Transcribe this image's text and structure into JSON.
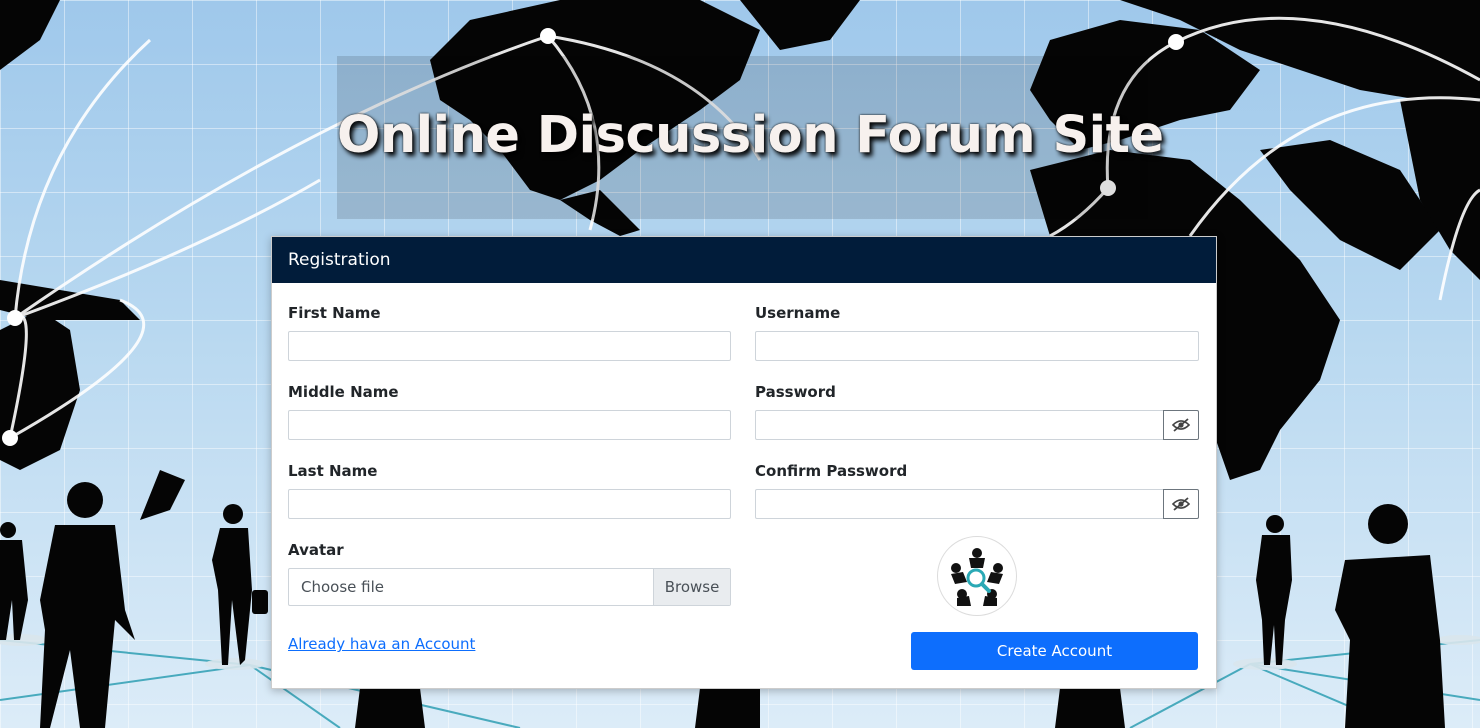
{
  "header": {
    "site_title": "Online Discussion Forum Site"
  },
  "registration": {
    "heading": "Registration",
    "fields": {
      "first_name": {
        "label": "First Name",
        "value": ""
      },
      "middle_name": {
        "label": "Middle Name",
        "value": ""
      },
      "last_name": {
        "label": "Last Name",
        "value": ""
      },
      "username": {
        "label": "Username",
        "value": ""
      },
      "password": {
        "label": "Password",
        "value": ""
      },
      "confirm_password": {
        "label": "Confirm Password",
        "value": ""
      }
    },
    "avatar": {
      "label": "Avatar",
      "file_placeholder": "Choose file",
      "browse_label": "Browse"
    },
    "signin_link": "Already hava an Account",
    "submit_label": "Create Account"
  },
  "icons": {
    "password_toggle": "eye-slash-icon",
    "avatar_preview": "forum-logo-icon"
  },
  "colors": {
    "header_bg": "#011c3a",
    "primary": "#0d6efd",
    "link": "#0d6efd"
  }
}
